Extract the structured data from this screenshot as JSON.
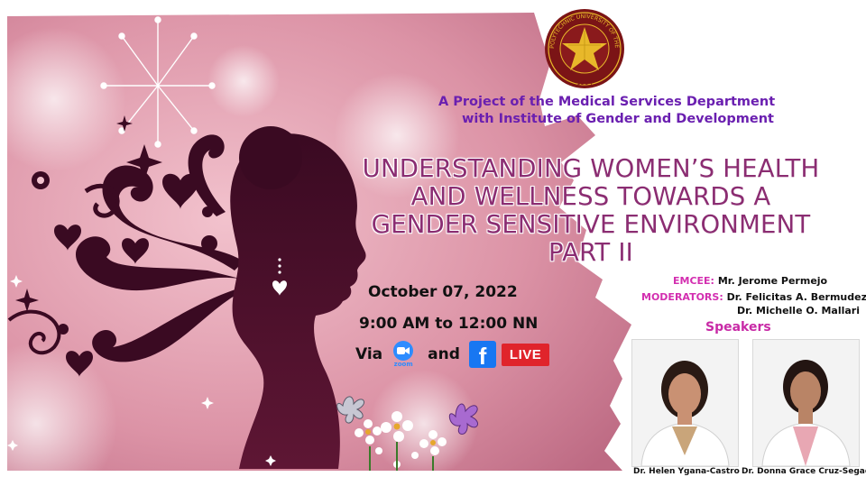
{
  "header": {
    "project_line1": "A Project of the Medical Services Department",
    "project_line2": "with Institute of Gender and Development"
  },
  "title": {
    "line1": "UNDERSTANDING WOMEN’S HEALTH",
    "line2": "AND WELLNESS TOWARDS A",
    "line3": "GENDER SENSITIVE ENVIRONMENT",
    "line4": "PART II"
  },
  "event": {
    "date": "October 07, 2022",
    "time": "9:00 AM to 12:00 NN",
    "via_label": "Via",
    "and_label": "and",
    "zoom_label": "zoom",
    "live_label": "LIVE",
    "platforms": [
      "zoom-icon",
      "facebook-icon"
    ]
  },
  "hosts": {
    "emcee_label": "EMCEE:",
    "emcee_name": "Mr. Jerome Permejo",
    "moderators_label": "MODERATORS:",
    "moderator1": "Dr. Felicitas A. Bermudez",
    "moderator2": "Dr. Michelle O. Mallari"
  },
  "speakers": {
    "heading": "Speakers",
    "items": [
      {
        "name": "Dr. Helen Ygana-Castro"
      },
      {
        "name": "Dr. Donna Grace Cruz-Segador"
      }
    ]
  },
  "logo": {
    "ring_text": "POLYTECHNIC UNIVERSITY OF THE PHILIPPINES",
    "year": "1904"
  },
  "colors": {
    "maroon": "#7b1416",
    "gold": "#e8b82a",
    "title_purple": "#8b2d72",
    "project_purple": "#6a1fb0",
    "label_magenta": "#d32fb0",
    "zoom_blue": "#2d8cff",
    "facebook_blue": "#1877f2",
    "live_red": "#e0242b"
  }
}
